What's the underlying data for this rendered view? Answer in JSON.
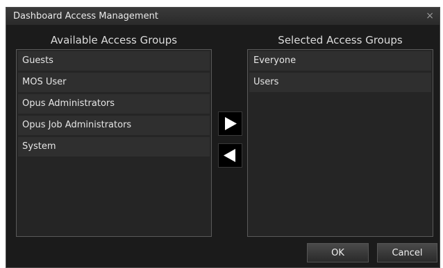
{
  "dialog": {
    "title": "Dashboard Access Management",
    "close_glyph": "×"
  },
  "available": {
    "heading": "Available Access Groups",
    "items": [
      "Guests",
      "MOS User",
      "Opus Administrators",
      "Opus Job Administrators",
      "System"
    ]
  },
  "selected": {
    "heading": "Selected Access Groups",
    "items": [
      "Everyone",
      "Users"
    ]
  },
  "buttons": {
    "ok": "OK",
    "cancel": "Cancel"
  },
  "icons": {
    "move_right": "arrow-right-icon",
    "move_left": "arrow-left-icon"
  }
}
